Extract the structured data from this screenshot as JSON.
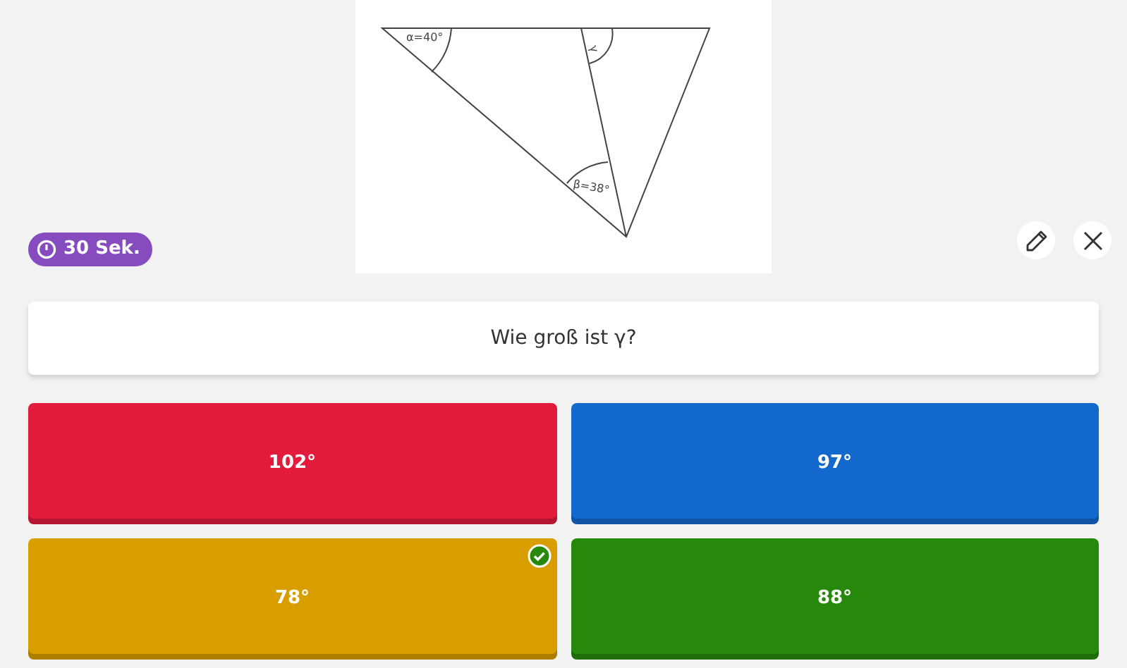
{
  "diagram": {
    "labels": [
      {
        "kind": "alpha",
        "text": "α=40°"
      },
      {
        "kind": "gamma",
        "text": "γ"
      },
      {
        "kind": "beta",
        "text": "β=38°"
      }
    ]
  },
  "timer": {
    "text": "30 Sek."
  },
  "question": {
    "text": "Wie groß ist γ?"
  },
  "answers": [
    {
      "text": "102°",
      "color": "#e21b3c",
      "correct": false
    },
    {
      "text": "97°",
      "color": "#1368ce",
      "correct": false
    },
    {
      "text": "78°",
      "color": "#d89e00",
      "correct": true
    },
    {
      "text": "88°",
      "color": "#26890c",
      "correct": false
    }
  ]
}
